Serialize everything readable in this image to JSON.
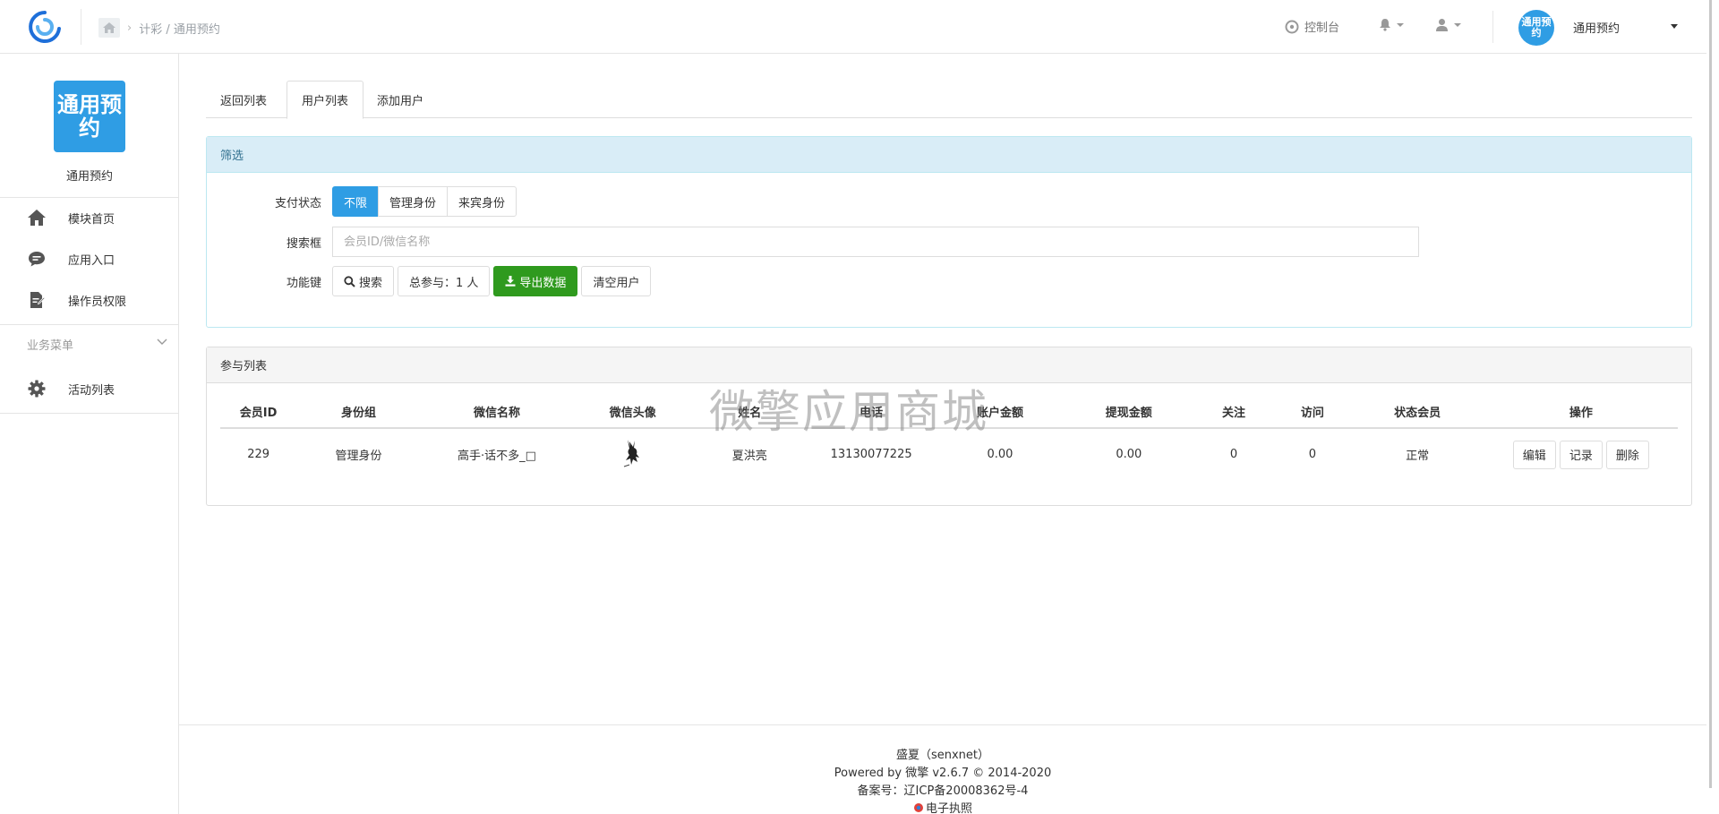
{
  "topbar": {
    "breadcrumb": "计彩 / 通用预约",
    "console_label": "控制台",
    "app_badge": "通用预约",
    "app_name": "通用预约"
  },
  "sidebar": {
    "logo_text": "通用预约",
    "title": "通用预约",
    "items": [
      {
        "label": "模块首页",
        "icon": "home-icon"
      },
      {
        "label": "应用入口",
        "icon": "chat-icon"
      },
      {
        "label": "操作员权限",
        "icon": "document-edit-icon"
      }
    ],
    "group_label": "业务菜单",
    "group_items": [
      {
        "label": "活动列表",
        "icon": "gear-icon"
      }
    ]
  },
  "tabs": [
    {
      "label": "返回列表"
    },
    {
      "label": "用户列表",
      "active": true
    },
    {
      "label": "添加用户"
    }
  ],
  "filter": {
    "title": "筛选",
    "pay_status_label": "支付状态",
    "pay_status_options": [
      "不限",
      "管理身份",
      "来宾身份"
    ],
    "pay_status_selected": "不限",
    "search_label": "搜索框",
    "search_placeholder": "会员ID/微信名称",
    "search_value": "",
    "functions_label": "功能键",
    "search_button": "搜索",
    "total_label": "总参与：1 人",
    "export_button": "导出数据",
    "clear_button": "清空用户"
  },
  "list": {
    "title": "参与列表",
    "columns": [
      "会员ID",
      "身份组",
      "微信名称",
      "微信头像",
      "姓名",
      "电话",
      "账户金额",
      "提现金额",
      "关注",
      "访问",
      "状态会员",
      "操作"
    ],
    "rows": [
      {
        "member_id": "229",
        "group": "管理身份",
        "wechat_name": "高手·话不多_□",
        "name": "夏洪亮",
        "phone": "13130077225",
        "balance": "0.00",
        "withdraw": "0.00",
        "follow": "0",
        "visit": "0",
        "status": "正常",
        "ops": [
          "编辑",
          "记录",
          "删除"
        ]
      }
    ]
  },
  "watermark": "微擎应用商城",
  "footer": {
    "line1": "盛夏（senxnet）",
    "line2": "Powered by 微擎 v2.6.7 © 2014-2020",
    "line3": "备案号：辽ICP备20008362号-4",
    "line4": "电子执照"
  },
  "colors": {
    "primary": "#2f9de4",
    "success": "#2f9a1e",
    "info_bg": "#d9edf7"
  }
}
